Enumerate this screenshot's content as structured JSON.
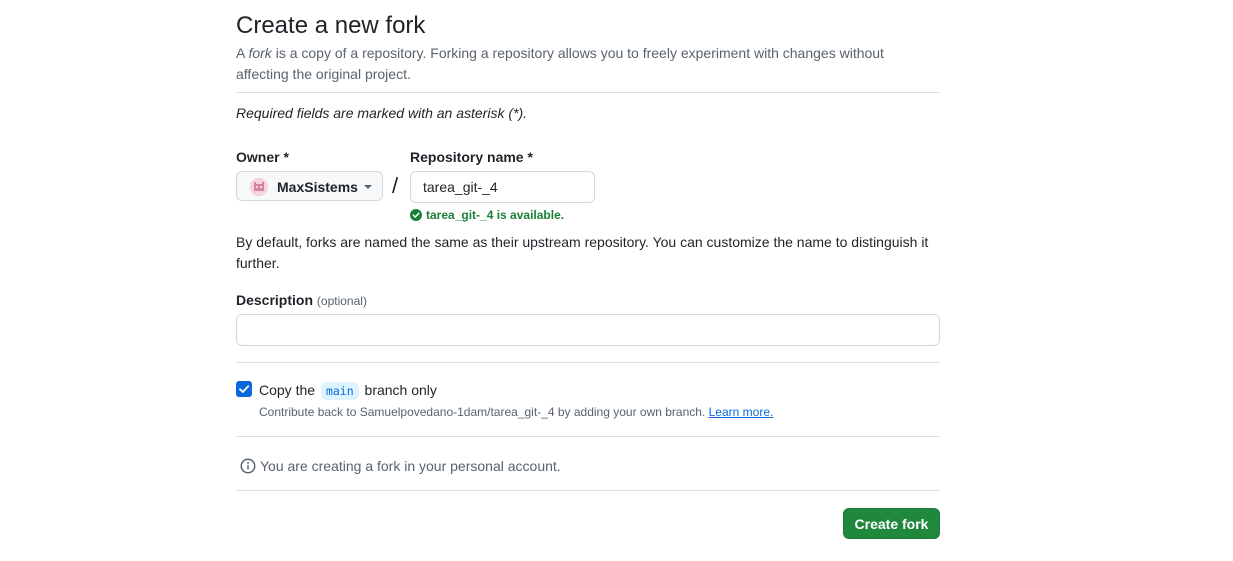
{
  "header": {
    "title": "Create a new fork",
    "subtitle_prefix": "A ",
    "subtitle_em": "fork",
    "subtitle_rest": " is a copy of a repository. Forking a repository allows you to freely experiment with changes without affecting the original project."
  },
  "required_note": "Required fields are marked with an asterisk (*).",
  "owner": {
    "label": "Owner *",
    "value": "MaxSistems",
    "icon": "caret-down-icon"
  },
  "separator": "/",
  "repository": {
    "label": "Repository name *",
    "value": "tarea_git-_4",
    "availability": "tarea_git-_4 is available.",
    "availability_color": "#1a7f37"
  },
  "default_note": "By default, forks are named the same as their upstream repository. You can customize the name to distinguish it further.",
  "description": {
    "label": "Description",
    "optional": "(optional)",
    "value": ""
  },
  "copy_branch": {
    "checked": true,
    "label_prefix": "Copy the",
    "branch": "main",
    "label_suffix": "branch only",
    "help_text": "Contribute back to Samuelpovedano-1dam/tarea_git-_4 by adding your own branch.",
    "learn_more": "Learn more."
  },
  "info_note": "You are creating a fork in your personal account.",
  "submit": {
    "label": "Create fork",
    "color": "#1f883d"
  }
}
